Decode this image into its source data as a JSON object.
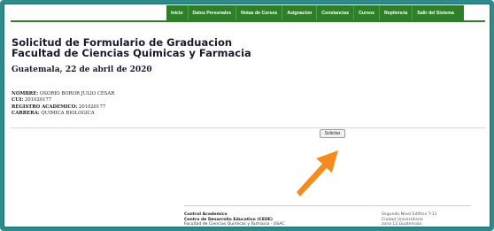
{
  "nav": {
    "items": [
      "Inicio",
      "Datos Personales",
      "Notas de Cursos",
      "Asignacion",
      "Constancias",
      "Cursos",
      "Repitencia",
      "Salir del Sistema"
    ]
  },
  "header": {
    "title_line1": "Solicitud de Formulario de Graduacion",
    "title_line2": "Facultad de Ciencias Quimicas y Farmacia"
  },
  "date": "Guatemala, 22 de abril de 2020",
  "student": {
    "nombre_label": "NOMBRE:",
    "nombre": "OSORIO BOROR JULIO CÉSAR",
    "cui_label": "CUI:",
    "cui": "201020177",
    "registro_label": "REGISTRO ACADEMICO:",
    "registro": "201020177",
    "carrera_label": "CARRERA:",
    "carrera": "QUIMICA BIOLOGICA"
  },
  "actions": {
    "solicitar_label": "Solicitar"
  },
  "annotation": {
    "arrow_color": "#f28c1e",
    "arrow_icon": "arrow-up-right-icon"
  },
  "footer": {
    "left_line1": "Control Academico",
    "left_line2": "Centro de Desarrollo Educativo (CEDE)",
    "left_line3": "Facultad de Ciencias Quimicas y Farmacia - USAC",
    "right_line1": "Segundo Nivel Edificio T-11",
    "right_line2": "Ciudad Universitaria",
    "right_line3": "zona 12,Guatemala"
  }
}
